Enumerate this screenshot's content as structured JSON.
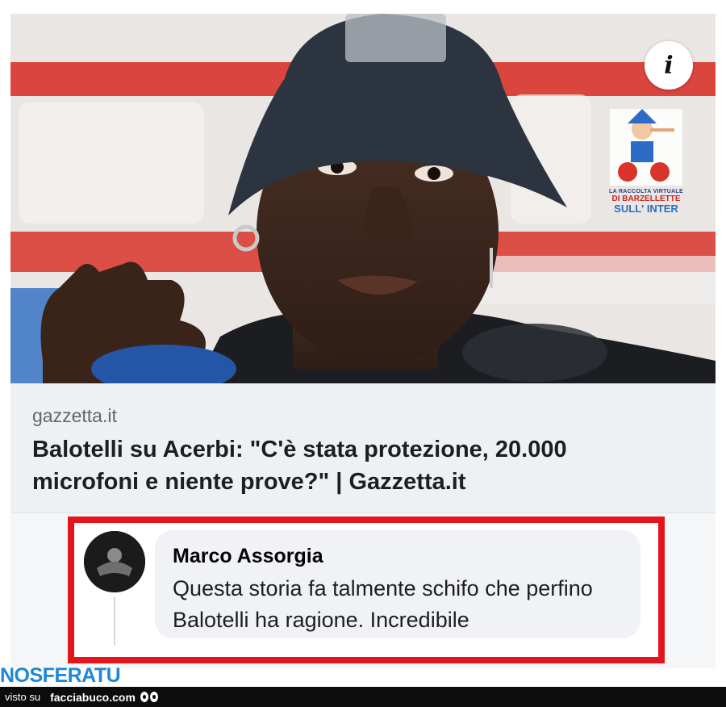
{
  "post": {
    "info_icon": "i",
    "link_preview": {
      "domain": "gazzetta.it",
      "title": "Balotelli su Acerbi: \"C'è stata protezione, 20.000 microfoni e niente prove?\" | Gazzetta.it"
    },
    "comment": {
      "author": "Marco Assorgia",
      "text": "Questa storia fa talmente schifo che perfino Balotelli ha ragione. Incredibile"
    }
  },
  "overlay": {
    "watermark": {
      "line1": "LA RACCOLTA VIRTUALE",
      "line2": "DI BARZELLETTE",
      "line3": "SULL' INTER"
    },
    "brand_tag": "NOSFERATU",
    "footer": {
      "label": "visto su",
      "site": "facciabuco.com"
    }
  },
  "colors": {
    "highlight": "#e3141b",
    "brand_tag": "#1e87d6",
    "backdrop_red": "#d8342b"
  },
  "icons": [
    "info-icon",
    "avatar-icon",
    "eyes-icon"
  ]
}
